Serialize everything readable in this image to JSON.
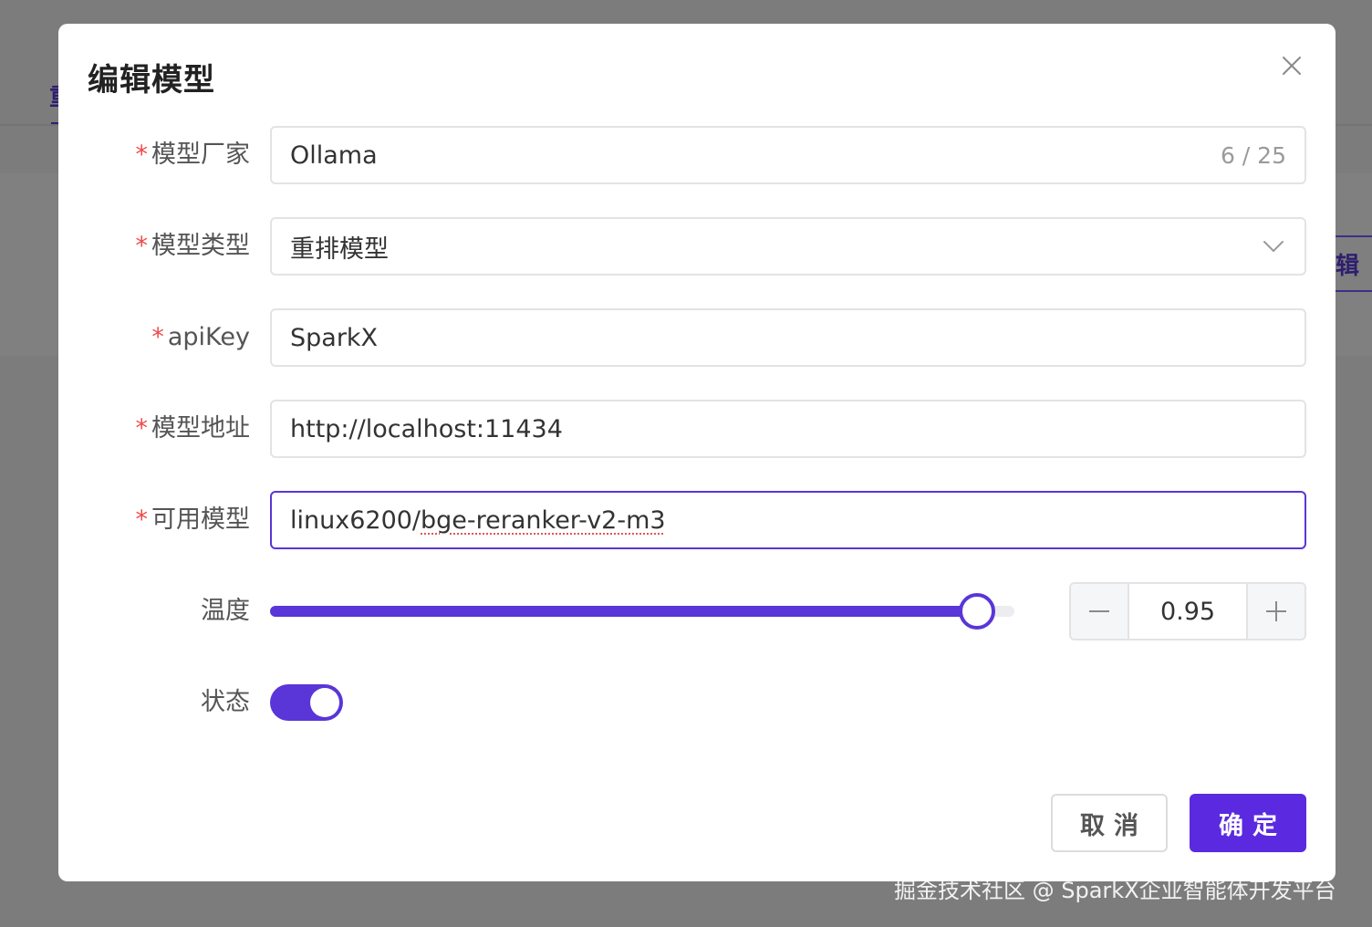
{
  "background": {
    "tab_glyph": "重",
    "edit_button_glyph": "辑"
  },
  "modal": {
    "title": "编辑模型",
    "close_icon": "close-icon"
  },
  "form": {
    "vendor": {
      "label": "模型厂家",
      "value": "Ollama",
      "counter": "6 / 25",
      "required": true
    },
    "type": {
      "label": "模型类型",
      "value": "重排模型",
      "required": true,
      "icon": "chevron-down-icon"
    },
    "apikey": {
      "label": "apiKey",
      "value": "SparkX",
      "required": true
    },
    "address": {
      "label": "模型地址",
      "value": "http://localhost:11434",
      "required": true
    },
    "available": {
      "label": "可用模型",
      "value_prefix": "linux6200/",
      "value_suffix": "bge-reranker-v2-m3",
      "required": true
    },
    "temperature": {
      "label": "温度",
      "value": "0.95",
      "fraction": 0.95
    },
    "status": {
      "label": "状态",
      "enabled": true
    }
  },
  "required_mark": "*",
  "footer": {
    "cancel_label": "取消",
    "ok_label": "确定"
  },
  "watermark": "掘金技术社区 @ SparkX企业智能体开发平台",
  "colors": {
    "accent": "#5a35d8",
    "primary_button": "#5a29e0",
    "required": "#ef4a4a",
    "overlay": "#7c7c7c"
  }
}
